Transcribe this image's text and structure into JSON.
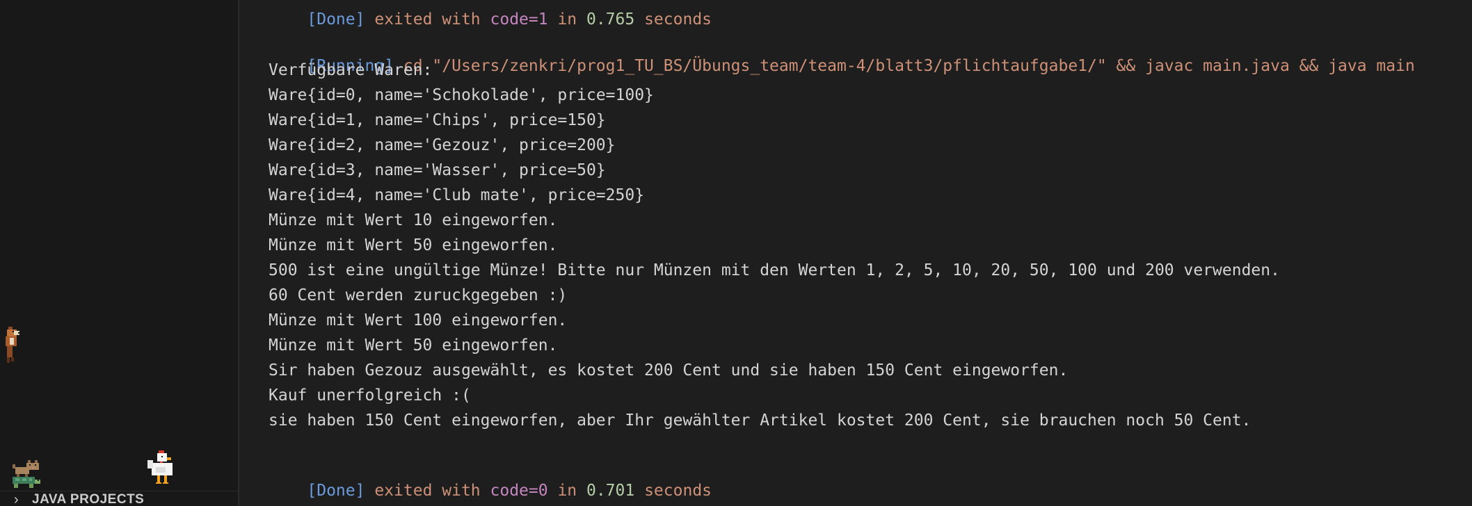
{
  "sidebar": {
    "section_title": "JAVA PROJECTS",
    "section_chevron": "›",
    "pets": [
      "cat-pet-icon",
      "turtle-pet-icon",
      "chicken-pet-icon",
      "fox-pet-icon"
    ]
  },
  "terminal": {
    "previous_run": {
      "tag": "[Done]",
      "text1": " exited with ",
      "code": "code=1",
      "text2": " in ",
      "time": "0.765",
      "text3": " seconds"
    },
    "running": {
      "tag": "[Running]",
      "command": " cd \"/Users/zenkri/prog1_TU_BS/Übungs_team/team-4/blatt3/pflichtaufgabe1/\" && javac main.java && java main"
    },
    "output": [
      "Verfügbare Waren:",
      "Ware{id=0, name='Schokolade', price=100}",
      "Ware{id=1, name='Chips', price=150}",
      "Ware{id=2, name='Gezouz', price=200}",
      "Ware{id=3, name='Wasser', price=50}",
      "Ware{id=4, name='Club mate', price=250}",
      "Münze mit Wert 10 eingeworfen.",
      "Münze mit Wert 50 eingeworfen.",
      "500 ist eine ungültige Münze! Bitte nur Münzen mit den Werten 1, 2, 5, 10, 20, 50, 100 und 200 verwenden.",
      "60 Cent werden zuruckgegeben :)",
      "Münze mit Wert 100 eingeworfen.",
      "Münze mit Wert 50 eingeworfen.",
      "Sir haben Gezouz ausgewählt, es kostet 200 Cent und sie haben 150 Cent eingeworfen.",
      "Kauf unerfolgreich :(",
      "sie haben 150 Cent eingeworfen, aber Ihr gewählter Artikel kostet 200 Cent, sie brauchen noch 50 Cent."
    ],
    "done": {
      "tag": "[Done]",
      "text1": " exited with ",
      "code": "code=0",
      "text2": " in ",
      "time": "0.701",
      "text3": " seconds"
    }
  }
}
